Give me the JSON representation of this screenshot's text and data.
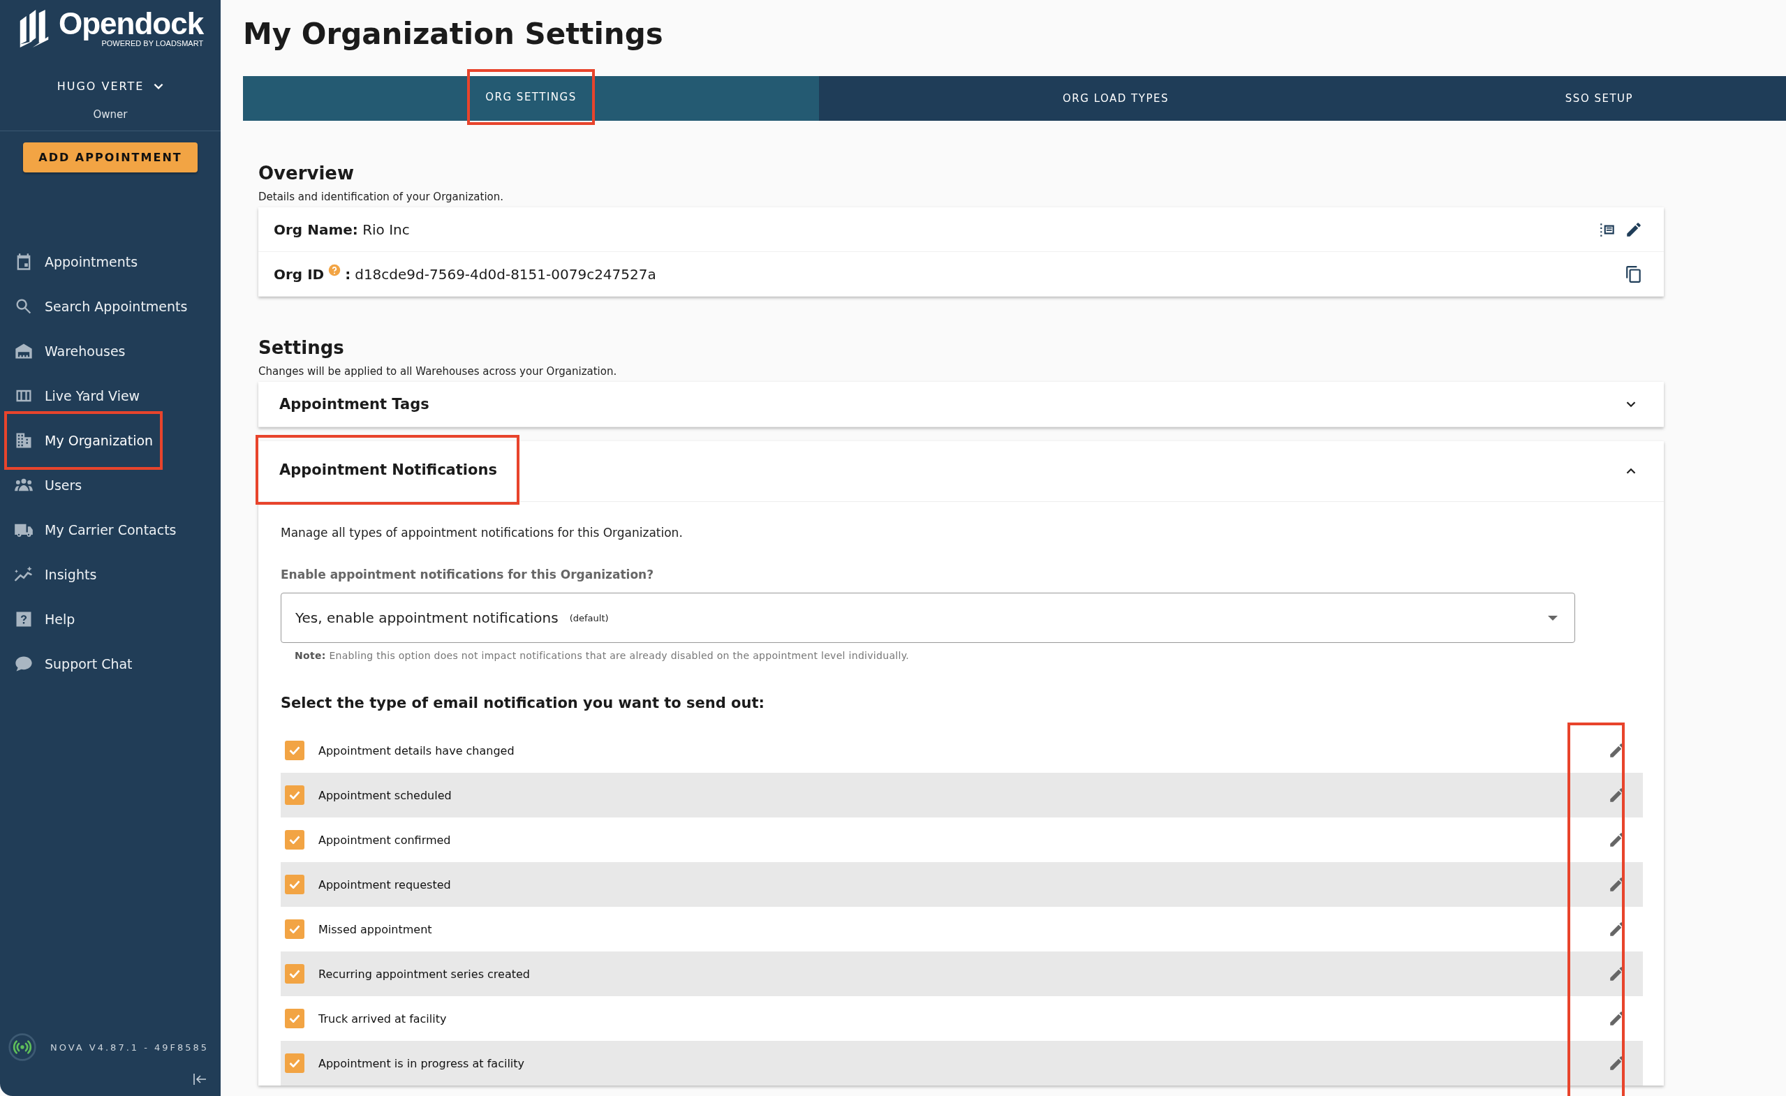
{
  "brand": {
    "name": "Opendock",
    "tagline": "POWERED BY LOADSMART"
  },
  "user": {
    "name": "HUGO VERTE",
    "role": "Owner"
  },
  "add_button": "ADD APPOINTMENT",
  "sidebar": {
    "items": [
      {
        "label": "Appointments",
        "selected": false,
        "highlighted": false
      },
      {
        "label": "Search Appointments",
        "selected": false,
        "highlighted": false
      },
      {
        "label": "Warehouses",
        "selected": false,
        "highlighted": false
      },
      {
        "label": "Live Yard View",
        "selected": false,
        "highlighted": false
      },
      {
        "label": "My Organization",
        "selected": true,
        "highlighted": true
      },
      {
        "label": "Users",
        "selected": false,
        "highlighted": false
      },
      {
        "label": "My Carrier Contacts",
        "selected": false,
        "highlighted": false
      },
      {
        "label": "Insights",
        "selected": false,
        "highlighted": false
      },
      {
        "label": "Help",
        "selected": false,
        "highlighted": false
      },
      {
        "label": "Support Chat",
        "selected": false,
        "highlighted": false
      }
    ]
  },
  "version": "NOVA V4.87.1 - 49F8585",
  "page_title": "My Organization Settings",
  "tabs": [
    {
      "label": "ORG SETTINGS",
      "selected": true,
      "highlighted": true
    },
    {
      "label": "ORG LOAD TYPES",
      "selected": false,
      "highlighted": false
    },
    {
      "label": "SSO SETUP",
      "selected": false,
      "highlighted": false
    }
  ],
  "overview": {
    "title": "Overview",
    "subtitle": "Details and identification of your Organization.",
    "org_name_label": "Org Name:",
    "org_name": "Rio Inc",
    "org_id_label": "Org ID",
    "org_id_sep": ":",
    "org_id": "d18cde9d-7569-4d0d-8151-0079c247527a"
  },
  "settings": {
    "title": "Settings",
    "subtitle": "Changes will be applied to all Warehouses across your Organization.",
    "panels": [
      {
        "title": "Appointment Tags",
        "expanded": false,
        "highlighted": false
      },
      {
        "title": "Appointment Notifications",
        "expanded": true,
        "highlighted": true
      }
    ]
  },
  "notifications": {
    "description": "Manage all types of appointment notifications for this Organization.",
    "select_label": "Enable appointment notifications for this Organization?",
    "select_value": "Yes, enable appointment notifications",
    "select_suffix": "(default)",
    "note": "**Note:** Enabling this option does not impact notifications that are already disabled on the appointment level individually.",
    "list_title": "Select the type of email notification you want to send out:",
    "edit_column_highlighted": true,
    "items": [
      {
        "label": "Appointment details have changed",
        "checked": true
      },
      {
        "label": "Appointment scheduled",
        "checked": true
      },
      {
        "label": "Appointment confirmed",
        "checked": true
      },
      {
        "label": "Appointment requested",
        "checked": true
      },
      {
        "label": "Missed appointment",
        "checked": true
      },
      {
        "label": "Recurring appointment series created",
        "checked": true
      },
      {
        "label": "Truck arrived at facility",
        "checked": true
      },
      {
        "label": "Appointment is in progress at facility",
        "checked": true
      }
    ]
  }
}
